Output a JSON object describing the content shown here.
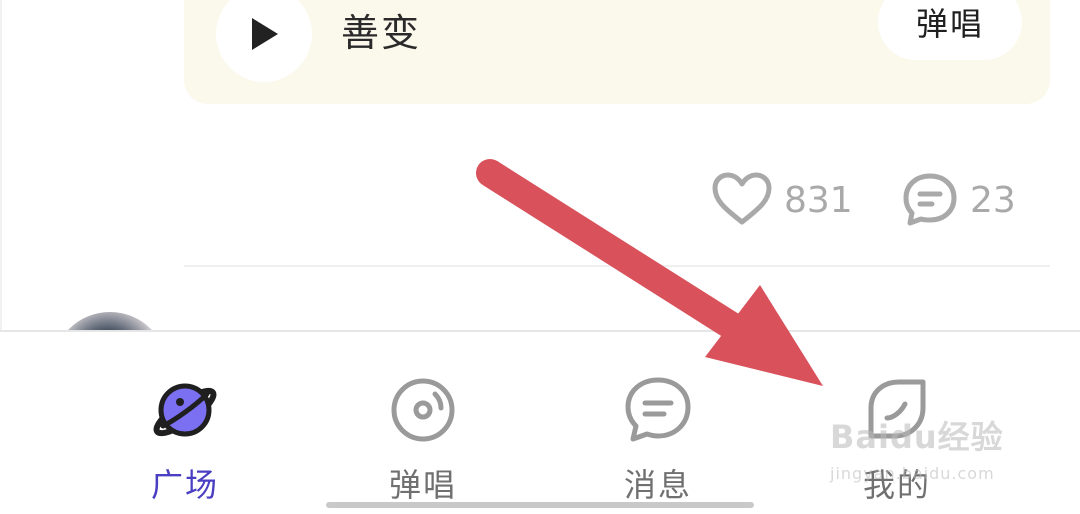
{
  "song_card": {
    "title": "善变",
    "sing_button_label": "弹唱",
    "play_icon": "play-icon"
  },
  "stats": {
    "likes": "831",
    "comments": "23"
  },
  "bottom_nav": {
    "items": [
      {
        "label": "广场",
        "icon": "planet-icon",
        "active": true
      },
      {
        "label": "弹唱",
        "icon": "disc-icon",
        "active": false
      },
      {
        "label": "消息",
        "icon": "chat-bubble-icon",
        "active": false
      },
      {
        "label": "我的",
        "icon": "leaf-icon",
        "active": false
      }
    ]
  },
  "watermark": {
    "logo": "Baidu经验",
    "url": "jingyan.baidu.com"
  },
  "colors": {
    "accent": "#4a3fc2",
    "planet": "#7b6ff2",
    "card_background": "#fbf8ec",
    "annotation_arrow": "#d9525b"
  }
}
